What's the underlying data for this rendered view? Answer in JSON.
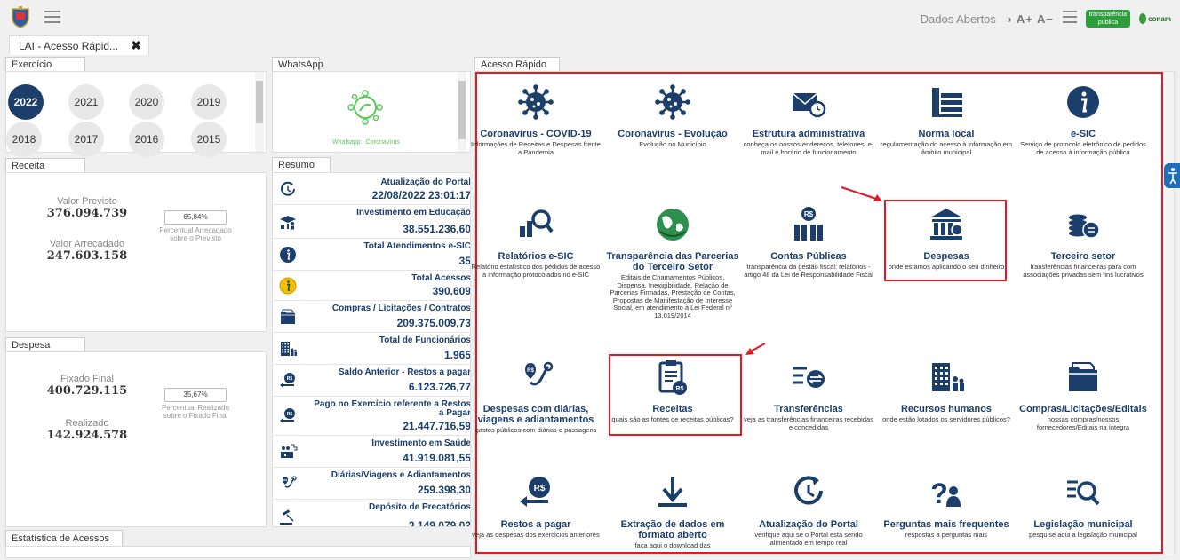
{
  "header": {
    "dados_abertos": "Dados Abertos",
    "accessibility": "◑ A+ A−",
    "transparencia_badge": "transparência pública",
    "conam": "conam"
  },
  "tab": {
    "label": "LAI - Acesso Rápid...",
    "close": "✖"
  },
  "exercicio": {
    "title": "Exercício",
    "years": [
      "2022",
      "2021",
      "2020",
      "2019",
      "2018",
      "2017",
      "2016",
      "2015"
    ],
    "selected": "2022"
  },
  "whatsapp": {
    "title": "WhatsApp",
    "caption": "Whatsapp - Coronavírus"
  },
  "receita": {
    "title": "Receita",
    "previsto_label": "Valor Previsto",
    "previsto_value": "376.094.739",
    "arrecadado_label": "Valor Arrecadado",
    "arrecadado_value": "247.603.158",
    "percent": "65,84%",
    "percent_label": "Percentual Arrecadado sobre o Previsto"
  },
  "despesa": {
    "title": "Despesa",
    "fixado_label": "Fixado Final",
    "fixado_value": "400.729.115",
    "realizado_label": "Realizado",
    "realizado_value": "142.924.578",
    "percent": "35,67%",
    "percent_label": "Percentual Realizado sobre o Fixado Final"
  },
  "estatistica": {
    "title": "Estatística de Acessos"
  },
  "resumo": {
    "title": "Resumo",
    "rows": [
      {
        "icon": "clock-refresh-icon",
        "label": "Atualização do Portal",
        "value": "22/08/2022 23:01:17"
      },
      {
        "icon": "education-icon",
        "label": "Investimento em Educação",
        "value": "38.551.236,60"
      },
      {
        "icon": "info-icon",
        "label": "Total Atendimentos e-SIC",
        "value": "35"
      },
      {
        "icon": "info-yellow-icon",
        "label": "Total Acessos",
        "value": "390.609"
      },
      {
        "icon": "folder-icon",
        "label": "Compras / Licitações / Contratos",
        "value": "209.375.009,73"
      },
      {
        "icon": "building-people-icon",
        "label": "Total de Funcionários",
        "value": "1.965"
      },
      {
        "icon": "money-arrow-icon",
        "label": "Saldo Anterior - Restos a pagar",
        "value": "6.123.726,77"
      },
      {
        "icon": "money-arrow-icon",
        "label": "Pago no Exercício referente a Restos a Pagar",
        "value": "21.447.716,59"
      },
      {
        "icon": "health-icon",
        "label": "Investimento em Saúde",
        "value": "41.919.081,55"
      },
      {
        "icon": "route-icon",
        "label": "Diárias/Viagens e Adiantamentos",
        "value": "259.398,30"
      },
      {
        "icon": "gavel-icon",
        "label": "Depósito de Precatórios",
        "value": "3.149.079,02"
      }
    ]
  },
  "acesso_rapido": {
    "title": "Acesso Rápido",
    "items": [
      {
        "icon": "virus-icon",
        "title": "Coronavírus - COVID-19",
        "desc": "Informações de Receitas e Despesas frente a Pandemia"
      },
      {
        "icon": "virus-icon",
        "title": "Coronavírus - Evolução",
        "desc": "Evolução no Município"
      },
      {
        "icon": "envelope-clock-icon",
        "title": "Estrutura administrativa",
        "desc": "conheça os nossos endereços, telefones, e-mail e horário de funcionamento"
      },
      {
        "icon": "books-icon",
        "title": "Norma local",
        "desc": "regulamentação do acesso à informação em âmbito municipal"
      },
      {
        "icon": "info-circle-icon",
        "title": "e-SIC",
        "desc": "Serviço de protocolo eletrônico de pedidos de acesso à informação pública"
      },
      {
        "icon": "chart-search-icon",
        "title": "Relatórios e-SIC",
        "desc": "Relatório estatístico dos pedidos de acesso à informação protocolados no e-SIC"
      },
      {
        "icon": "globe-icon",
        "title": "Transparência das Parcerias do Terceiro Setor",
        "desc": "Editais de Chamamentos Públicos, Dispensa, Inexigibilidade, Relação de Parcerias Firmadas, Prestação de Contas, Propostas de Manifestação de Interesse Social, em atendimento à Lei Federal nº 13.019/2014"
      },
      {
        "icon": "bars-money-icon",
        "title": "Contas Públicas",
        "desc": "transparência da gestão fiscal: relatórios - artigo 48 da Lei de Responsabilidade Fiscal"
      },
      {
        "icon": "bank-icon",
        "title": "Despesas",
        "desc": "onde estamos aplicando o seu dinheiro"
      },
      {
        "icon": "coins-icon",
        "title": "Terceiro setor",
        "desc": "transferências financeiras para com associações privadas sem fins lucrativos"
      },
      {
        "icon": "route-icon",
        "title": "Despesas com diárias, viagens e adiantamentos",
        "desc": "gastos públicos com diárias e passagens"
      },
      {
        "icon": "clipboard-money-icon",
        "title": "Receitas",
        "desc": "quais são as fontes de receitas públicas?"
      },
      {
        "icon": "transfer-icon",
        "title": "Transferências",
        "desc": "veja as transferências financeiras recebidas e concedidas"
      },
      {
        "icon": "building-people-icon",
        "title": "Recursos humanos",
        "desc": "onde estão lotados os servidores públicos?"
      },
      {
        "icon": "folder-icon",
        "title": "Compras/Licitações/Editais",
        "desc": "nossas compras/nossos fornecedores/Editais na íntegra"
      },
      {
        "icon": "money-arrow-icon",
        "title": "Restos a pagar",
        "desc": "veja as despesas dos exercícios anteriores"
      },
      {
        "icon": "download-icon",
        "title": "Extração de dados em formato aberto",
        "desc": "faça aqui o download das"
      },
      {
        "icon": "clock-refresh-icon",
        "title": "Atualização do Portal",
        "desc": "verifique aqui se o Portal está sendo alimentado em tempo real"
      },
      {
        "icon": "question-person-icon",
        "title": "Perguntas mais frequentes",
        "desc": "respostas a perguntas mais"
      },
      {
        "icon": "list-search-icon",
        "title": "Legislação municipal",
        "desc": "pesquise aqui a legislação municipal"
      }
    ]
  }
}
